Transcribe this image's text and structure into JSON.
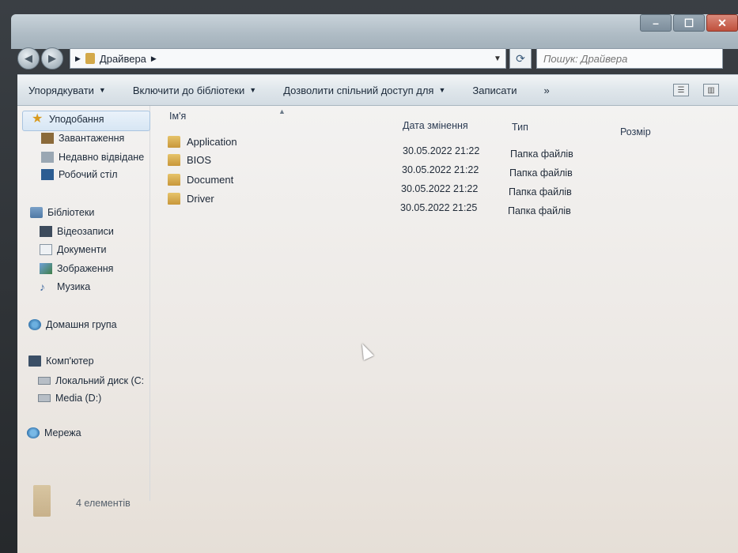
{
  "address": {
    "path_segment": "Драйвера"
  },
  "search": {
    "placeholder": "Пошук: Драйвера"
  },
  "toolbar": {
    "organize": "Упорядкувати",
    "include_library": "Включити до бібліотеки",
    "share_with": "Дозволити спільний доступ для",
    "burn": "Записати",
    "more": "»"
  },
  "sidebar": {
    "favorites": {
      "label": "Уподобання",
      "items": [
        {
          "label": "Завантаження",
          "icon": "downloads-icon"
        },
        {
          "label": "Недавно відвідане",
          "icon": "recent-places-icon"
        },
        {
          "label": "Робочий стіл",
          "icon": "desktop-icon"
        }
      ]
    },
    "libraries": {
      "label": "Бібліотеки",
      "items": [
        {
          "label": "Відеозаписи",
          "icon": "videos-icon"
        },
        {
          "label": "Документи",
          "icon": "documents-icon"
        },
        {
          "label": "Зображення",
          "icon": "pictures-icon"
        },
        {
          "label": "Музика",
          "icon": "music-icon"
        }
      ]
    },
    "homegroup": {
      "label": "Домашня група"
    },
    "computer": {
      "label": "Комп'ютер",
      "items": [
        {
          "label": "Локальний диск (C:",
          "icon": "disk-icon"
        },
        {
          "label": "Media (D:)",
          "icon": "disk-icon"
        }
      ]
    },
    "network": {
      "label": "Мережа"
    }
  },
  "columns": {
    "name": "Ім'я",
    "date_modified": "Дата змінення",
    "type": "Тип",
    "size": "Розмір"
  },
  "files": [
    {
      "name": "Application",
      "date": "30.05.2022 21:22",
      "type": "Папка файлів"
    },
    {
      "name": "BIOS",
      "date": "30.05.2022 21:22",
      "type": "Папка файлів"
    },
    {
      "name": "Document",
      "date": "30.05.2022 21:22",
      "type": "Папка файлів"
    },
    {
      "name": "Driver",
      "date": "30.05.2022 21:25",
      "type": "Папка файлів"
    }
  ],
  "status": {
    "item_count": "4 елементів"
  },
  "colors": {
    "folder": "#d3a94a",
    "selection": "#d7e6f4",
    "close_button": "#c0503c"
  }
}
